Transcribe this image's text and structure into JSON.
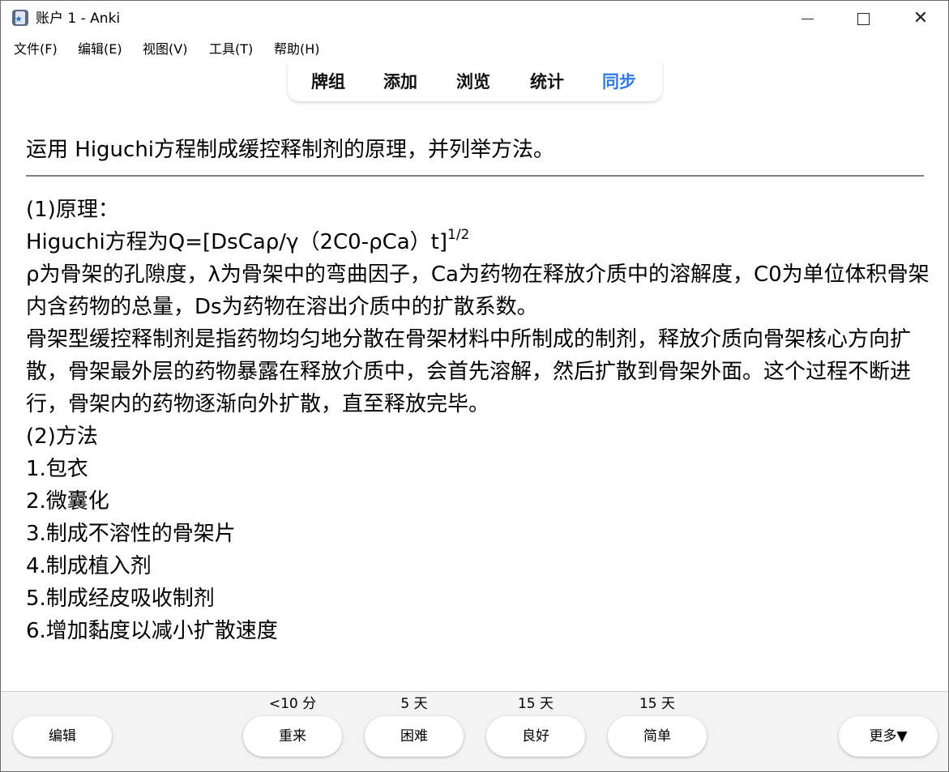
{
  "window": {
    "title": "账户 1 - Anki"
  },
  "menu": {
    "items": [
      "文件(F)",
      "编辑(E)",
      "视图(V)",
      "工具(T)",
      "帮助(H)"
    ]
  },
  "toolbar": {
    "items": [
      "牌组",
      "添加",
      "浏览",
      "统计",
      "同步"
    ],
    "active": "同步",
    "accent_color": "#2f7ae5"
  },
  "card": {
    "question": "运用 Higuchi方程制成缓控释制剂的原理，并列举方法。",
    "answer": {
      "principle_heading": "(1)原理：",
      "equation_prefix": "Higuchi方程为Q=[DsCaρ/γ（2C0-ρCa）t]",
      "equation_exponent": "1/2",
      "definitions": "ρ为骨架的孔隙度，λ为骨架中的弯曲因子，Ca为药物在释放介质中的溶解度，C0为单位体积骨架内含药物的总量，Ds为药物在溶出介质中的扩散系数。",
      "description": "骨架型缓控释制剂是指药物均匀地分散在骨架材料中所制成的制剂，释放介质向骨架核心方向扩散，骨架最外层的药物暴露在释放介质中，会首先溶解，然后扩散到骨架外面。这个过程不断进行，骨架内的药物逐渐向外扩散，直至释放完毕。",
      "methods_heading": "(2)方法",
      "methods": [
        "1.包衣",
        "2.微囊化",
        "3.制成不溶性的骨架片",
        "4.制成植入剂",
        "5.制成经皮吸收制剂",
        "6.增加黏度以减小扩散速度"
      ]
    }
  },
  "bottom": {
    "edit_label": "编辑",
    "more_label": "更多▼",
    "answers": [
      {
        "interval": "<10 分",
        "label": "重来"
      },
      {
        "interval": "5 天",
        "label": "困难"
      },
      {
        "interval": "15 天",
        "label": "良好"
      },
      {
        "interval": "15 天",
        "label": "简单"
      }
    ]
  }
}
